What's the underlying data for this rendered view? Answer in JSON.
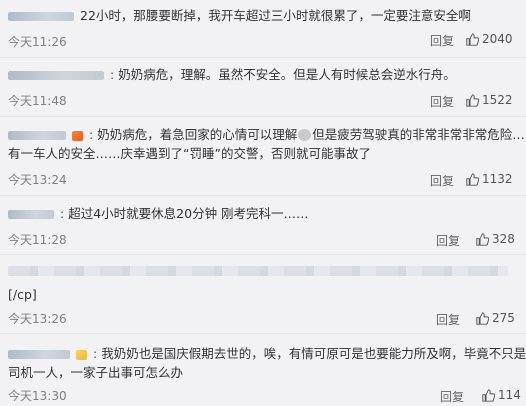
{
  "comments": [
    {
      "text": "22小时，那腰要断掉，我开车超过三小时就很累了，一定要注意安全啊",
      "time": "今天11:26",
      "reply": "回复",
      "likes": "2040"
    },
    {
      "text": "奶奶病危，理解。虽然不安全。但是人有时候总会逆水行舟。",
      "time": "今天11:48",
      "reply": "回复",
      "likes": "1522"
    },
    {
      "text_line1_a": "奶奶病危，着急回家的心情可以理解",
      "text_line1_b": "但是疲劳驾驶真的非常非常非常危险……还",
      "text_line2": "有一车人的安全……庆幸遇到了“罚睡”的交警，否则就可能事故了",
      "time": "今天13:24",
      "reply": "回复",
      "likes": "1132"
    },
    {
      "text": "超过4小时就要休息20分钟 刚考完科一……",
      "time": "今天11:28",
      "reply": "回复",
      "likes": "328"
    },
    {
      "text": "[/cp]",
      "time": "今天13:26",
      "reply": "回复",
      "likes": "275"
    },
    {
      "text_line1": "我奶奶也是国庆假期去世的，唉，有情可原可是也要能力所及啊，毕竟不只是",
      "text_line2": "司机一人，一家子出事可怎么办",
      "time": "今天13:30",
      "reply": "回复",
      "likes": "114"
    }
  ],
  "icons": {
    "like": "thumbs-up-icon",
    "username": "blurred-username",
    "emoji": "emoji-icon"
  },
  "colors": {
    "background": "#f2f2f5",
    "text": "#333333",
    "time": "#808080",
    "separator": "#e4e4e8"
  }
}
